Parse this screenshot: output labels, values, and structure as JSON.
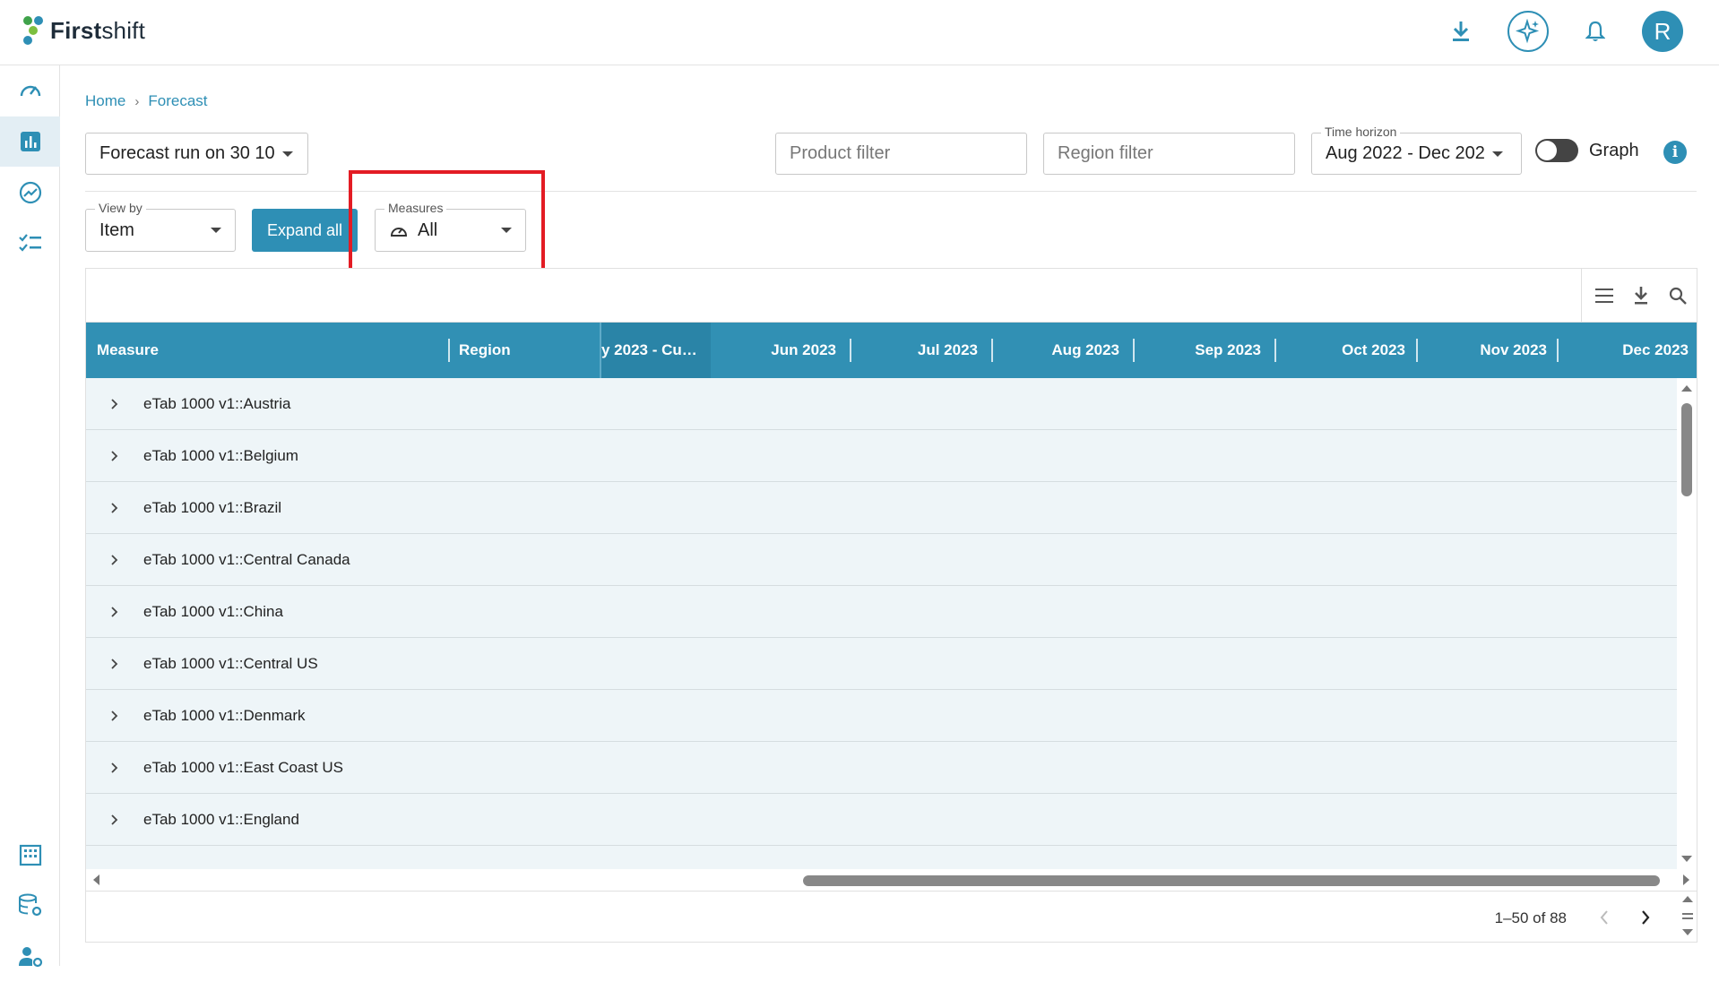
{
  "app": {
    "logo_bold": "First",
    "logo_rest": "shift"
  },
  "breadcrumb": {
    "home": "Home",
    "separator": "›",
    "current": "Forecast"
  },
  "controls": {
    "forecast_run": "Forecast run on 30 10",
    "product_filter_placeholder": "Product filter",
    "region_filter_placeholder": "Region filter",
    "time_horizon_label": "Time horizon",
    "time_horizon_value": "Aug 2022 - Dec 202",
    "graph_label": "Graph",
    "view_by_label": "View by",
    "view_by_value": "Item",
    "expand_all": "Expand all",
    "measures_label": "Measures",
    "measures_value": "All"
  },
  "grid": {
    "columns": [
      "Measure",
      "Region",
      "y 2023 - Cu…",
      "Jun 2023",
      "Jul 2023",
      "Aug 2023",
      "Sep 2023",
      "Oct 2023",
      "Nov 2023",
      "Dec 2023"
    ],
    "rows": [
      "eTab 1000 v1::Austria",
      "eTab 1000 v1::Belgium",
      "eTab 1000 v1::Brazil",
      "eTab 1000 v1::Central Canada",
      "eTab 1000 v1::China",
      "eTab 1000 v1::Central US",
      "eTab 1000 v1::Denmark",
      "eTab 1000 v1::East Coast US",
      "eTab 1000 v1::England"
    ],
    "pagination": "1–50 of 88"
  },
  "colors": {
    "accent": "#2e8fb5",
    "header": "#3190b4",
    "highlight": "#e31c24"
  }
}
